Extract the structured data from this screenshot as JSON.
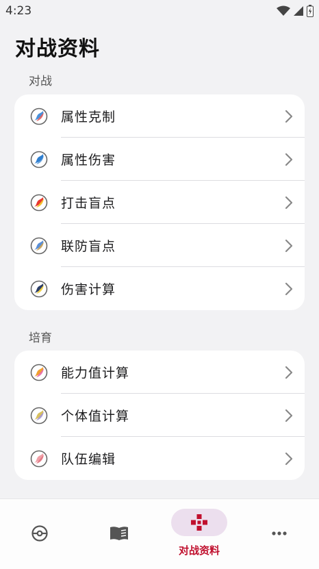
{
  "status": {
    "time": "4:23"
  },
  "page": {
    "title": "对战资料"
  },
  "sections": [
    {
      "label": "对战",
      "items": [
        {
          "label": "属性克制",
          "icon": "type-matchup-icon",
          "colors": [
            "#4a90d9",
            "#e25d5d"
          ]
        },
        {
          "label": "属性伤害",
          "icon": "type-damage-icon",
          "colors": [
            "#2f7fd0",
            "#2f7fd0"
          ]
        },
        {
          "label": "打击盲点",
          "icon": "coverage-icon",
          "colors": [
            "#e8382f",
            "#f3c22b"
          ]
        },
        {
          "label": "联防盲点",
          "icon": "team-defense-icon",
          "colors": [
            "#5b8fd6",
            "#c8a055"
          ]
        },
        {
          "label": "伤害计算",
          "icon": "damage-calc-icon",
          "colors": [
            "#2c3e66",
            "#f0d040"
          ]
        }
      ]
    },
    {
      "label": "培育",
      "items": [
        {
          "label": "能力值计算",
          "icon": "stat-calc-icon",
          "colors": [
            "#f0a030",
            "#e86aa8"
          ]
        },
        {
          "label": "个体值计算",
          "icon": "iv-calc-icon",
          "colors": [
            "#d8c060",
            "#a090d0"
          ]
        },
        {
          "label": "队伍编辑",
          "icon": "team-edit-icon",
          "colors": [
            "#f0a0a8",
            "#e0707c"
          ]
        }
      ]
    }
  ],
  "bottom_nav": {
    "items": [
      {
        "icon": "pokeball-icon",
        "label": ""
      },
      {
        "icon": "book-icon",
        "label": ""
      },
      {
        "icon": "gamepad-icon",
        "label": "对战资料",
        "active": true
      },
      {
        "icon": "more-icon",
        "label": ""
      }
    ]
  },
  "colors": {
    "accent": "#c0102e",
    "active_pill": "#ecdfee",
    "background": "#f2f2f4"
  }
}
